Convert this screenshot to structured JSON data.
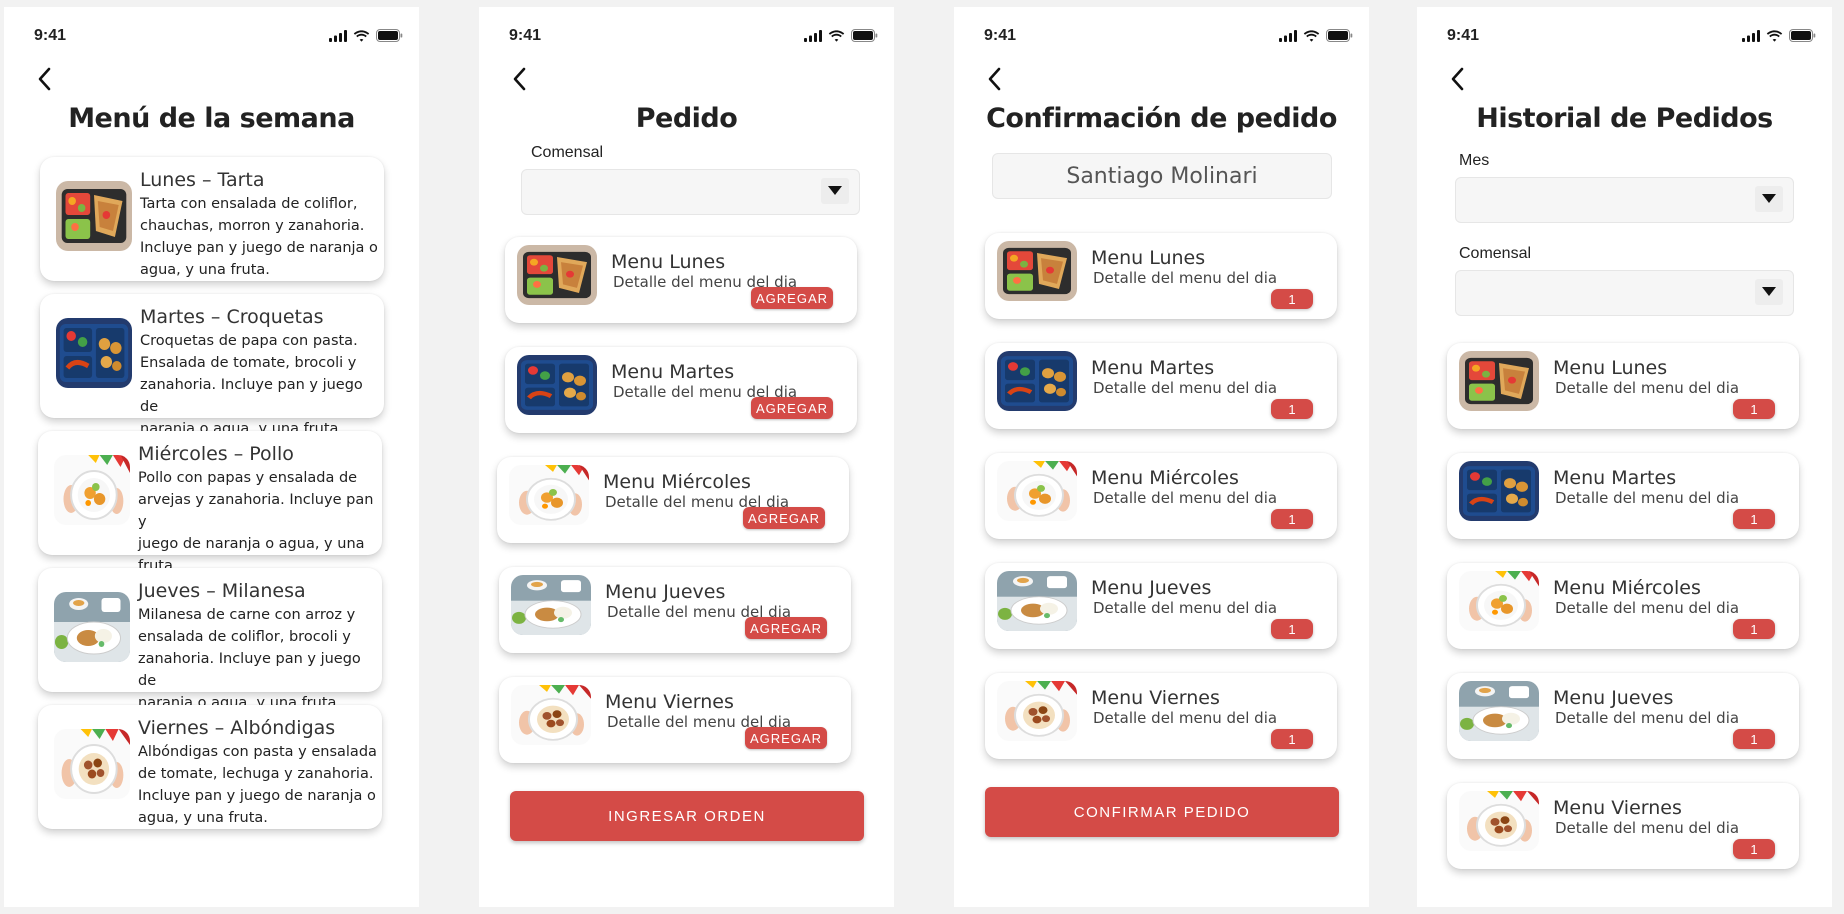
{
  "status": {
    "time": "9:41"
  },
  "colors": {
    "accent": "#d44b47",
    "background": "#f2f2f2",
    "screen": "#ffffff"
  },
  "icons": {
    "back": "chevron-left-icon",
    "dropdown": "triangle-down-icon",
    "signal": "signal-icon",
    "wifi": "wifi-icon",
    "battery": "battery-icon"
  },
  "screen1": {
    "title": "Menú de la semana",
    "items": [
      {
        "title": "Lunes – Tarta",
        "desc": [
          "Tarta con ensalada de coliflor,",
          "chauchas, morron y zanahoria.",
          "Incluye pan y juego de naranja o",
          "agua, y una fruta."
        ]
      },
      {
        "title": "Martes – Croquetas",
        "desc": [
          "Croquetas de papa con pasta.",
          "Ensalada de tomate, brocoli y",
          "zanahoria. Incluye pan y juego de",
          "naranja o agua, y una fruta."
        ]
      },
      {
        "title": "Miércoles – Pollo",
        "desc": [
          "Pollo con papas y ensalada de",
          "arvejas y zanahoria. Incluye pan y",
          "juego de naranja o agua, y una",
          "fruta."
        ]
      },
      {
        "title": "Jueves – Milanesa",
        "desc": [
          "Milanesa de carne con arroz y",
          "ensalada de coliflor, brocoli y",
          "zanahoria. Incluye pan y juego de",
          "naranja o agua, y una fruta."
        ]
      },
      {
        "title": "Viernes – Albóndigas",
        "desc": [
          "Albóndigas con pasta y ensalada",
          "de tomate, lechuga y zanahoria.",
          "Incluye pan y juego de naranja o",
          "agua, y una fruta."
        ]
      }
    ]
  },
  "screen2": {
    "title": "Pedido",
    "comensal_label": "Comensal",
    "comensal_value": "",
    "add_label": "AGREGAR",
    "items": [
      {
        "title": "Menu Lunes",
        "sub": "Detalle del menu del dia"
      },
      {
        "title": "Menu Martes",
        "sub": "Detalle del menu del dia"
      },
      {
        "title": "Menu Miércoles",
        "sub": "Detalle del menu del dia"
      },
      {
        "title": "Menu Jueves",
        "sub": "Detalle del menu del dia"
      },
      {
        "title": "Menu Viernes",
        "sub": "Detalle del menu del dia"
      }
    ],
    "button": "INGRESAR ORDEN"
  },
  "screen3": {
    "title": "Confirmación de pedido",
    "name": "Santiago Molinari",
    "items": [
      {
        "title": "Menu Lunes",
        "sub": "Detalle del menu del dia",
        "qty": "1"
      },
      {
        "title": "Menu Martes",
        "sub": "Detalle del menu del dia",
        "qty": "1"
      },
      {
        "title": "Menu Miércoles",
        "sub": "Detalle del menu del dia",
        "qty": "1"
      },
      {
        "title": "Menu Jueves",
        "sub": "Detalle del menu del dia",
        "qty": "1"
      },
      {
        "title": "Menu Viernes",
        "sub": "Detalle del menu del dia",
        "qty": "1"
      }
    ],
    "button": "CONFIRMAR PEDIDO"
  },
  "screen4": {
    "title": "Historial de Pedidos",
    "mes_label": "Mes",
    "mes_value": "",
    "comensal_label": "Comensal",
    "comensal_value": "",
    "items": [
      {
        "title": "Menu Lunes",
        "sub": "Detalle del menu del dia",
        "qty": "1"
      },
      {
        "title": "Menu Martes",
        "sub": "Detalle del menu del dia",
        "qty": "1"
      },
      {
        "title": "Menu Miércoles",
        "sub": "Detalle del menu del dia",
        "qty": "1"
      },
      {
        "title": "Menu Jueves",
        "sub": "Detalle del menu del dia",
        "qty": "1"
      },
      {
        "title": "Menu Viernes",
        "sub": "Detalle del menu del dia",
        "qty": "1"
      }
    ]
  }
}
